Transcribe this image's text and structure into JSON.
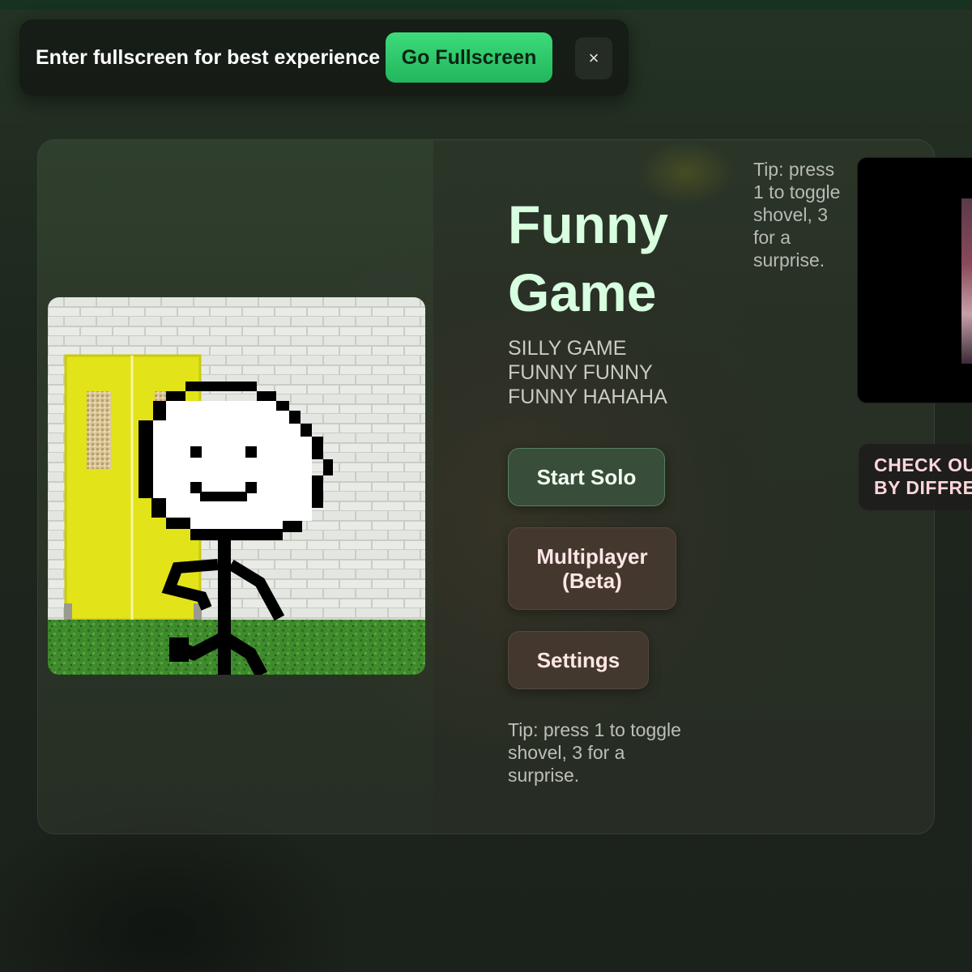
{
  "fullscreen_banner": {
    "message": "Enter fullscreen for best experience",
    "button_label": "Go Fullscreen",
    "close_label": "×"
  },
  "game": {
    "title": "Funny Game",
    "subtitle": "SILLY GAME FUNNY FUNNY FUNNY HAHAHA",
    "tip_bottom": "Tip: press 1 to toggle shovel, 3 for a surprise.",
    "tip_side": "Tip: press 1 to toggle shovel, 3 for a surprise.",
    "menu": {
      "solo_label": "Start Solo",
      "multiplayer_label": "Multiplayer (Beta)",
      "settings_label": "Settings"
    }
  },
  "promo": {
    "banner_text": "CHECK OU\nBY DIFFRE"
  },
  "colors": {
    "accent_green": "#22b65c",
    "title_color": "#d8ffe0",
    "button_text": "#ffe6e6"
  }
}
